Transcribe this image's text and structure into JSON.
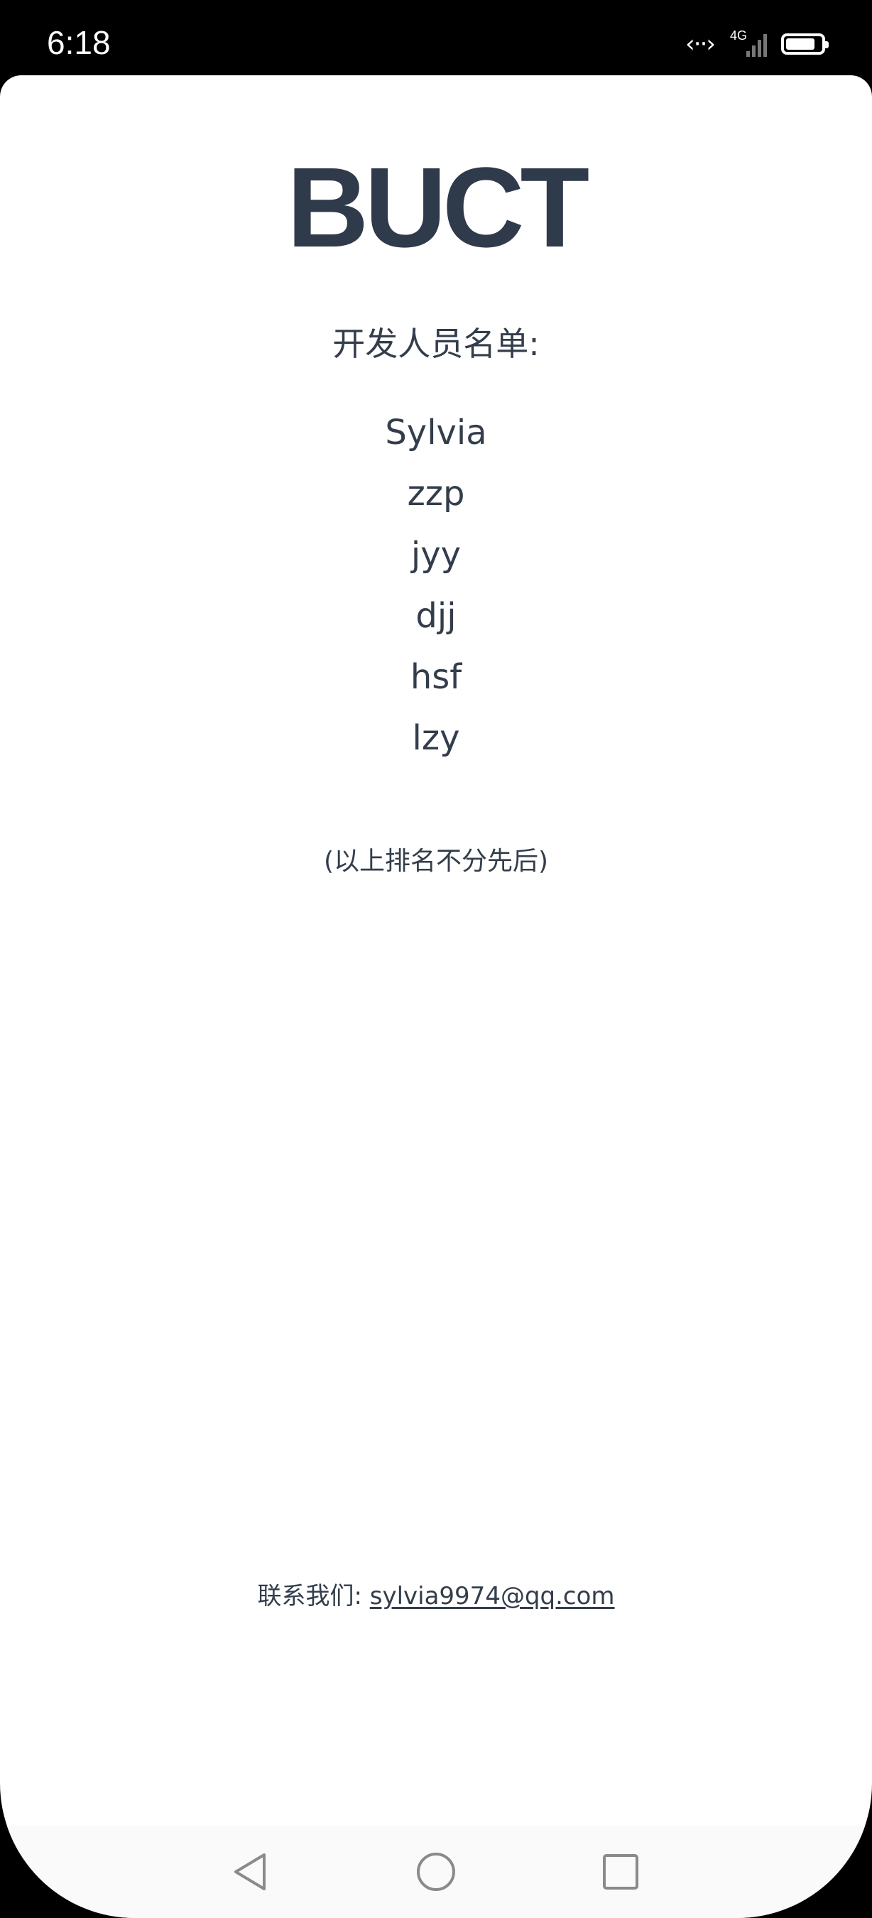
{
  "status_bar": {
    "time": "6:18",
    "network_type": "4G",
    "icons": [
      "data-transfer-icon",
      "signal-icon",
      "battery-icon"
    ],
    "battery_level": 0.95
  },
  "app": {
    "title": "BUCT",
    "list_heading": "开发人员名单:",
    "developers": [
      "Sylvia",
      "zzp",
      "jyy",
      "djj",
      "hsf",
      "lzy"
    ],
    "order_note": "(以上排名不分先后)",
    "contact_label": "联系我们:",
    "contact_email": "sylvia9974@qq.com"
  },
  "nav_bar": {
    "buttons": [
      "back-icon",
      "home-icon",
      "recent-apps-icon"
    ]
  },
  "colors": {
    "text": "#2f3a4a",
    "background": "#ffffff",
    "status_bar": "#000000"
  }
}
